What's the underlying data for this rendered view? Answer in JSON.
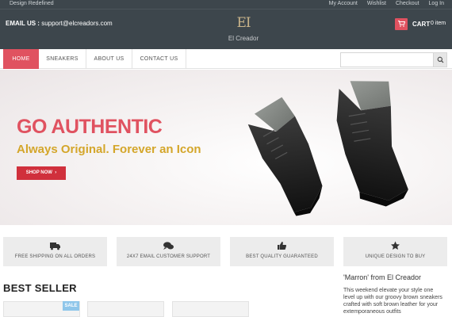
{
  "topbar": {
    "tagline": "Design Redefined",
    "links": [
      "My Account",
      "Wishlist",
      "Checkout",
      "Log In"
    ]
  },
  "header": {
    "email_label": "EMAIL US :",
    "email": "support@elcreadors.com",
    "logo_mark": "EI",
    "logo_name": "El Creador",
    "cart_label": "CART",
    "cart_count": "0 item"
  },
  "nav": {
    "items": [
      "HOME",
      "SNEAKERS",
      "ABOUT US",
      "CONTACT US"
    ],
    "active_index": 0,
    "search_placeholder": ""
  },
  "hero": {
    "title": "GO AUTHENTIC",
    "subtitle": "Always Original. Forever an Icon",
    "button": "SHOP NOW"
  },
  "features": [
    {
      "icon": "truck-icon",
      "label": "FREE SHIPPING ON ALL ORDERS"
    },
    {
      "icon": "chat-icon",
      "label": "24X7 EMAIL CUSTOMER SUPPORT"
    },
    {
      "icon": "thumbs-up-icon",
      "label": "BEST QUALITY GUARANTEED"
    },
    {
      "icon": "star-icon",
      "label": "UNIQUE DESIGN TO BUY"
    }
  ],
  "best_seller": {
    "heading": "BEST SELLER",
    "badge": "SALE"
  },
  "promo": {
    "title": "'Marron' from El Creador",
    "text": "This weekend elevate your style one level up with our groovy brown sneakers crafted with soft brown leather for your extemporaneous outfits"
  },
  "colors": {
    "accent": "#e05260",
    "header_bg": "#3d464c",
    "gold": "#d4a62a",
    "sale_badge": "#8fc6ea"
  }
}
